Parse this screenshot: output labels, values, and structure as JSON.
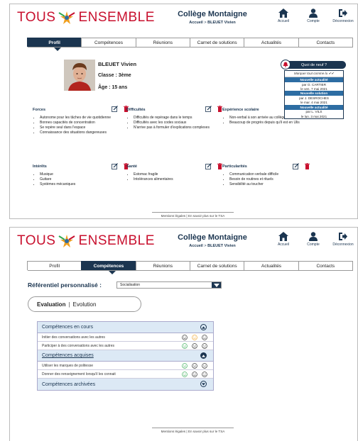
{
  "brand": {
    "left": "TOUS",
    "right": "ENSEMBLE",
    "color": "#c8102e"
  },
  "school": {
    "name": "Collège Montaigne",
    "crumb_home": "Accueil",
    "crumb_sep": " > ",
    "crumb_current": "BLEUET Vivien"
  },
  "topnav": {
    "home": "Accueil",
    "account": "Compte",
    "logout": "Déconnexion"
  },
  "tabs": [
    "Profil",
    "Compétences",
    "Réunions",
    "Carnet de solutions",
    "Actualités",
    "Contacts"
  ],
  "colors": {
    "navy": "#1b3550",
    "accent_blue": "#2d6da3",
    "danger": "#c8102e",
    "smile_green": "#2fa84f",
    "smile_orange": "#f0a020"
  },
  "profile": {
    "name": "BLEUET Vivien",
    "class": "Classe : 3ème",
    "age": "Âge : 15 ans"
  },
  "news": {
    "button": "Quoi de neuf ?",
    "mark_all": "Marquer tout comme lu",
    "items": [
      {
        "head": "Nouvelle actualité",
        "by": "par O. CARTIER",
        "date": "le ven. 7 mai 2021"
      },
      {
        "head": "Nouvelle solution",
        "by": "par J. DESROCHES",
        "date": "le mar. 4 mai 2021"
      },
      {
        "head": "Nouvelle actualité",
        "by": "par L. VILS",
        "date": "le lun. 3 mai 2021"
      }
    ]
  },
  "sections": {
    "forces": {
      "title": "Forces",
      "items": [
        "Autonome pour les tâches de vie quotidienne",
        "Bonnes capacités de concentration",
        "Se repère seul dans l'espace",
        "Connaissance des situations dangereuses"
      ]
    },
    "difficultes": {
      "title": "Difficultés",
      "items": [
        "Difficultés de repérage dans le temps",
        "Difficultés avec les codes sociaux",
        "N'arrive pas à formuler d'explications complexes"
      ]
    },
    "experience": {
      "title": "Expérience scolaire",
      "items": [
        "Non-verbal à son arrivée au collège en 2019",
        "Beaucoup de progrès depuis qu'il est en Ulis"
      ]
    },
    "interets": {
      "title": "Intérêts",
      "items": [
        "Musique",
        "Guitare",
        "Systèmes mécaniques"
      ]
    },
    "sante": {
      "title": "Santé",
      "items": [
        "Estomac fragile",
        "Intolérances alimentaires"
      ]
    },
    "particularites": {
      "title": "Particularités",
      "items": [
        "Communication verbale difficile",
        "Besoin de routines et rituels",
        "Sensibilité au toucher"
      ]
    }
  },
  "footer": {
    "legal": "Mentions légales",
    "sep": "|",
    "more": "En savoir plus sur le TSA"
  },
  "competences": {
    "ref_label": "Référentiel personnalisé :",
    "ref_value": "Socialisation",
    "view_eval": "Evaluation",
    "view_sep": "|",
    "view_evo": "Evolution",
    "groups": [
      {
        "title": "Compétences en cours",
        "rows": [
          {
            "label": "Initier des conversations avec les autres",
            "state": "neutral"
          },
          {
            "label": "Participer à des conversations avec les autres",
            "state": "happy"
          }
        ]
      },
      {
        "title": "Compétences acquises",
        "rows": [
          {
            "label": "Utiliser les marques de politesse",
            "state": "happy"
          },
          {
            "label": "Donner des renseignement lorsqu'il les connait",
            "state": "happy"
          }
        ]
      },
      {
        "title": "Compétences archivées",
        "rows": []
      }
    ]
  }
}
